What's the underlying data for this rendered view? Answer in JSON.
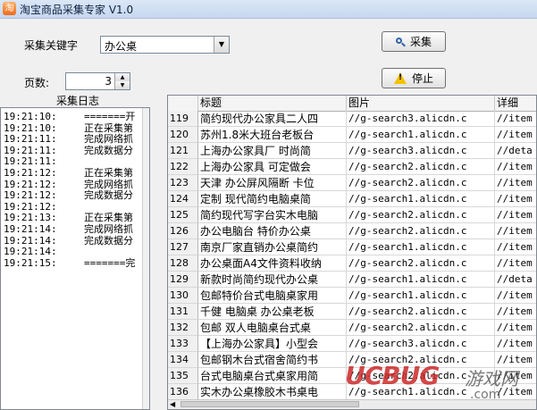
{
  "window": {
    "title": "淘宝商品采集专家 V1.0",
    "icon": "app-icon"
  },
  "form": {
    "keyword_label": "采集关键字",
    "keyword_value": "办公桌",
    "pages_label": "页数:",
    "pages_value": "3"
  },
  "buttons": {
    "search": "采集",
    "stop": "停止"
  },
  "log": {
    "title": "采集日志",
    "lines": [
      {
        "time": "19:21:10:",
        "text": "=======开"
      },
      {
        "time": "19:21:10:",
        "text": "正在采集第"
      },
      {
        "time": "19:21:11:",
        "text": "完成网络抓"
      },
      {
        "time": "19:21:11:",
        "text": "完成数据分"
      },
      {
        "time": "19:21:11:",
        "text": ""
      },
      {
        "time": "19:21:12:",
        "text": "正在采集第"
      },
      {
        "time": "19:21:12:",
        "text": "完成网络抓"
      },
      {
        "time": "19:21:12:",
        "text": "完成数据分"
      },
      {
        "time": "19:21:12:",
        "text": ""
      },
      {
        "time": "19:21:13:",
        "text": "正在采集第"
      },
      {
        "time": "19:21:14:",
        "text": "完成网络抓"
      },
      {
        "time": "19:21:14:",
        "text": "完成数据分"
      },
      {
        "time": "19:21:14:",
        "text": ""
      },
      {
        "time": "19:21:15:",
        "text": "=======完"
      }
    ]
  },
  "grid": {
    "columns": [
      "",
      "标题",
      "图片",
      "详细"
    ],
    "rows": [
      {
        "idx": "119",
        "title": "简约现代办公家具二人四",
        "img": "//g-search3.alicdn.c",
        "detail": "//item"
      },
      {
        "idx": "120",
        "title": "苏州1.8米大班台老板台",
        "img": "//g-search1.alicdn.c",
        "detail": "//item"
      },
      {
        "idx": "121",
        "title": "上海办公家具厂 时尚简",
        "img": "//g-search3.alicdn.c",
        "detail": "//deta"
      },
      {
        "idx": "122",
        "title": "上海办公家具 可定做会",
        "img": "//g-search2.alicdn.c",
        "detail": "//item"
      },
      {
        "idx": "123",
        "title": "天津 办公屏风隔断 卡位",
        "img": "//g-search2.alicdn.c",
        "detail": "//item"
      },
      {
        "idx": "124",
        "title": "定制 现代简约电脑桌简",
        "img": "//g-search1.alicdn.c",
        "detail": "//item"
      },
      {
        "idx": "125",
        "title": "简约现代写字台实木电脑",
        "img": "//g-search2.alicdn.c",
        "detail": "//item"
      },
      {
        "idx": "126",
        "title": "办公电脑台 特价办公桌",
        "img": "//g-search2.alicdn.c",
        "detail": "//item"
      },
      {
        "idx": "127",
        "title": "南京厂家直销办公桌简约",
        "img": "//g-search1.alicdn.c",
        "detail": "//item"
      },
      {
        "idx": "128",
        "title": "办公桌面A4文件资料收纳",
        "img": "//g-search2.alicdn.c",
        "detail": "//item"
      },
      {
        "idx": "129",
        "title": "新款时尚简约现代办公桌",
        "img": "//g-search1.alicdn.c",
        "detail": "//deta"
      },
      {
        "idx": "130",
        "title": "包邮特价台式电脑桌家用",
        "img": "//g-search1.alicdn.c",
        "detail": "//item"
      },
      {
        "idx": "131",
        "title": "千健 电脑桌 办公桌老板",
        "img": "//g-search2.alicdn.c",
        "detail": "//item"
      },
      {
        "idx": "132",
        "title": "包邮 双人电脑桌台式桌",
        "img": "//g-search2.alicdn.c",
        "detail": "//item"
      },
      {
        "idx": "133",
        "title": "【上海办公家具】小型会",
        "img": "//g-search3.alicdn.c",
        "detail": "//item"
      },
      {
        "idx": "134",
        "title": "包邮钢木台式宿舍简约书",
        "img": "//g-search2.alicdn.c",
        "detail": "//item"
      },
      {
        "idx": "135",
        "title": "台式电脑桌台式桌家用简",
        "img": "//g-search2.alicdn.c",
        "detail": "//item"
      },
      {
        "idx": "136",
        "title": "实木办公桌橡胶木书桌电",
        "img": "//g-search1.alicdn.c",
        "detail": "//item"
      }
    ]
  },
  "watermark": {
    "brand": "UCBUG",
    "cn": "游戏网",
    "domain": ".com"
  }
}
